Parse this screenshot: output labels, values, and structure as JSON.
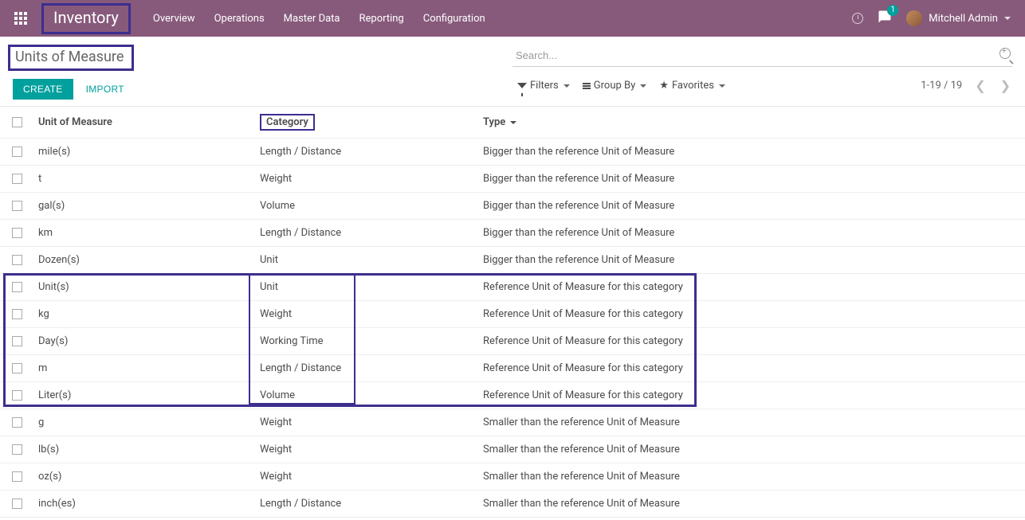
{
  "topbar": {
    "brand": "Inventory",
    "nav": [
      "Overview",
      "Operations",
      "Master Data",
      "Reporting",
      "Configuration"
    ],
    "chat_badge": "1",
    "user_name": "Mitchell Admin"
  },
  "page": {
    "title": "Units of Measure",
    "create_btn": "CREATE",
    "import_btn": "IMPORT"
  },
  "search": {
    "placeholder": "Search..."
  },
  "toolbar": {
    "filters": "Filters",
    "groupby": "Group By",
    "favorites": "Favorites",
    "pager": "1-19 / 19"
  },
  "columns": {
    "uom": "Unit of Measure",
    "category": "Category",
    "type": "Type"
  },
  "rows": [
    {
      "uom": "mile(s)",
      "category": "Length / Distance",
      "type": "Bigger than the reference Unit of Measure"
    },
    {
      "uom": "t",
      "category": "Weight",
      "type": "Bigger than the reference Unit of Measure"
    },
    {
      "uom": "gal(s)",
      "category": "Volume",
      "type": "Bigger than the reference Unit of Measure"
    },
    {
      "uom": "km",
      "category": "Length / Distance",
      "type": "Bigger than the reference Unit of Measure"
    },
    {
      "uom": "Dozen(s)",
      "category": "Unit",
      "type": "Bigger than the reference Unit of Measure"
    },
    {
      "uom": "Unit(s)",
      "category": "Unit",
      "type": "Reference Unit of Measure for this category"
    },
    {
      "uom": "kg",
      "category": "Weight",
      "type": "Reference Unit of Measure for this category"
    },
    {
      "uom": "Day(s)",
      "category": "Working Time",
      "type": "Reference Unit of Measure for this category"
    },
    {
      "uom": "m",
      "category": "Length / Distance",
      "type": "Reference Unit of Measure for this category"
    },
    {
      "uom": "Liter(s)",
      "category": "Volume",
      "type": "Reference Unit of Measure for this category"
    },
    {
      "uom": "g",
      "category": "Weight",
      "type": "Smaller than the reference Unit of Measure"
    },
    {
      "uom": "lb(s)",
      "category": "Weight",
      "type": "Smaller than the reference Unit of Measure"
    },
    {
      "uom": "oz(s)",
      "category": "Weight",
      "type": "Smaller than the reference Unit of Measure"
    },
    {
      "uom": "inch(es)",
      "category": "Length / Distance",
      "type": "Smaller than the reference Unit of Measure"
    }
  ]
}
